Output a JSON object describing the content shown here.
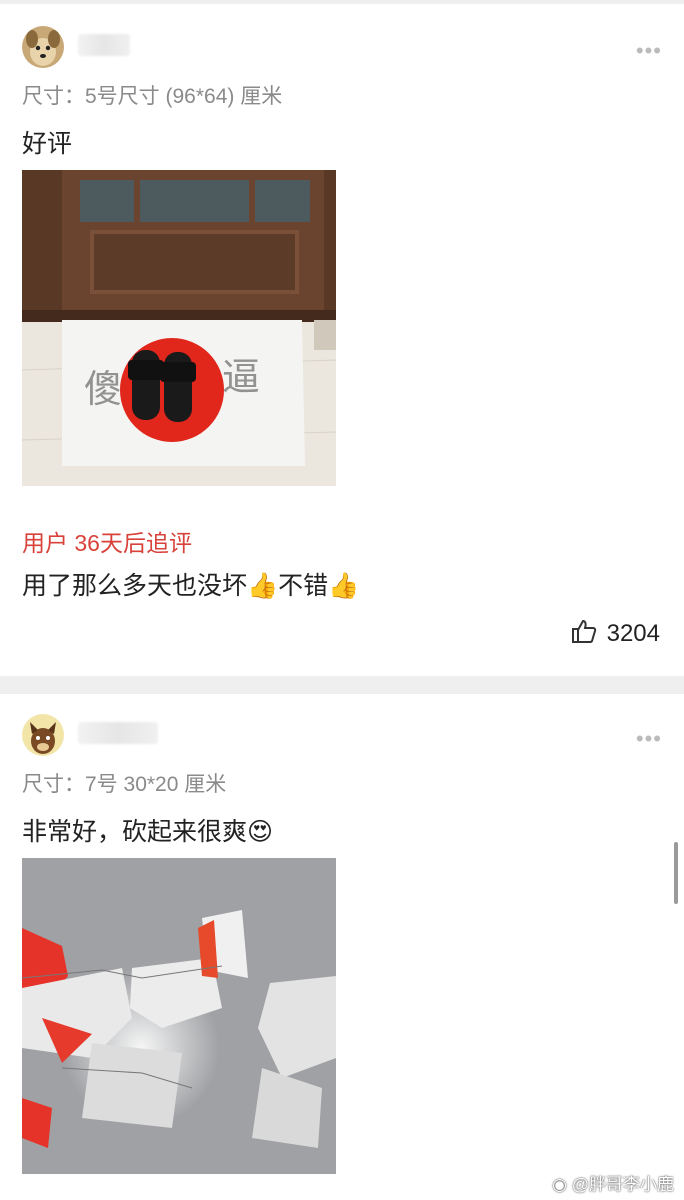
{
  "reviews": [
    {
      "spec": "尺寸：5号尺寸 (96*64) 厘米",
      "text": "好评",
      "followup_label": "用户 36天后追评",
      "followup_text": "用了那么多天也没坏👍不错👍",
      "likes": "3204"
    },
    {
      "spec": "尺寸：7号 30*20 厘米",
      "text": "非常好，砍起来很爽😍"
    }
  ],
  "photo_marks": [
    "傻",
    "逼"
  ],
  "icons": {
    "more": "more-dots-icon",
    "like": "thumbs-up-icon",
    "watermark": "weibo-icon"
  },
  "watermark": "@胖哥李小鹿",
  "colors": {
    "followup": "#d9423a",
    "divider": "#efefef",
    "spec": "#8a8a8a"
  }
}
